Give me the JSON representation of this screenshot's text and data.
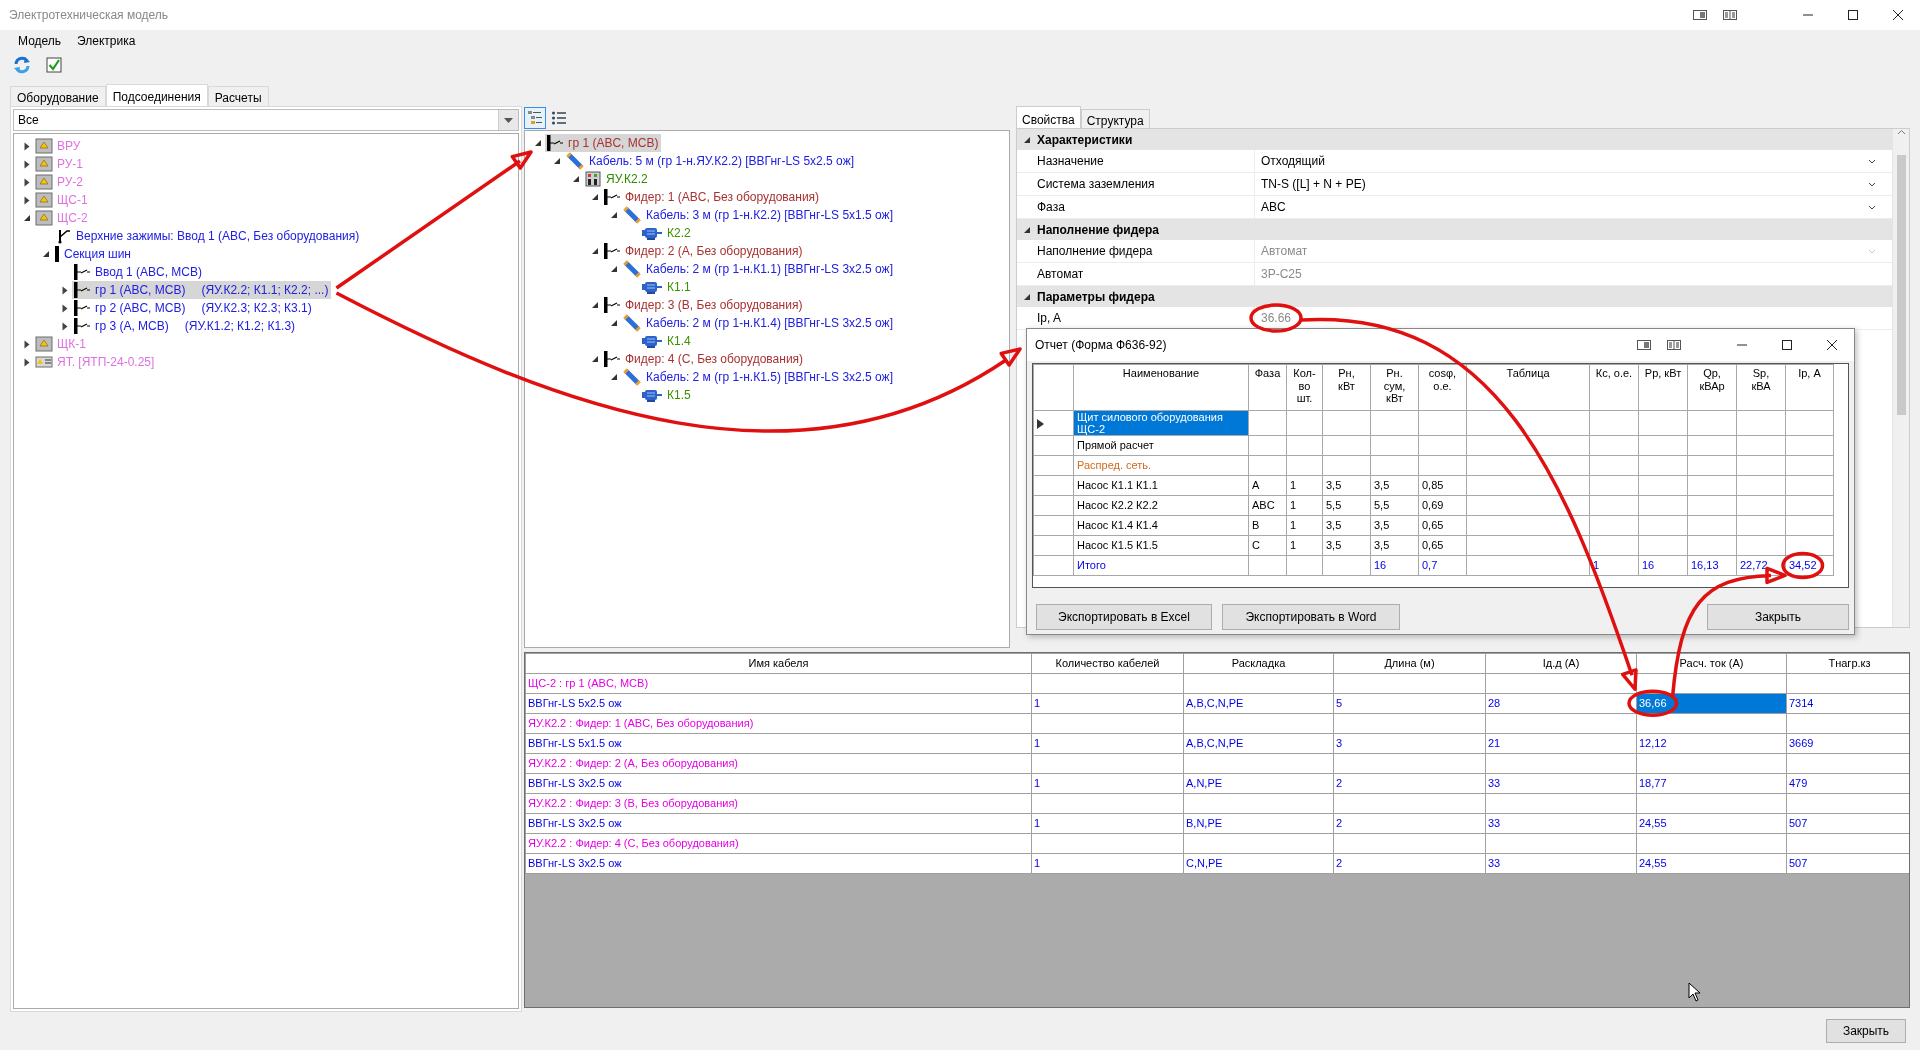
{
  "window": {
    "title": "Электротехническая модель"
  },
  "menu": [
    "Модель",
    "Электрика"
  ],
  "left_tabs": [
    {
      "label": "Оборудование",
      "selected": false
    },
    {
      "label": "Подсоединения",
      "selected": true
    },
    {
      "label": "Расчеты",
      "selected": false
    }
  ],
  "filter": {
    "value": "Все"
  },
  "equipment_tree": [
    {
      "label": "ВРУ",
      "kind": "panel",
      "expanded": false,
      "selected": false
    },
    {
      "label": "РУ-1",
      "kind": "panel",
      "expanded": false,
      "selected": false
    },
    {
      "label": "РУ-2",
      "kind": "panel",
      "expanded": false,
      "selected": false
    },
    {
      "label": "ЩС-1",
      "kind": "panel",
      "expanded": false,
      "selected": false
    },
    {
      "label": "ЩС-2",
      "kind": "panel",
      "expanded": true,
      "selected": false,
      "children": [
        {
          "label": "Верхние зажимы: Ввод 1 (ABC, Без оборудования)",
          "kind": "input",
          "selected": false
        },
        {
          "label": "Секция шин",
          "kind": "bus",
          "expanded": true,
          "selected": false,
          "children": [
            {
              "label": "Ввод 1 (ABC, MCB)",
              "kind": "breaker",
              "selected": false
            },
            {
              "label": "гр 1 (ABC, MCB)",
              "detail": "(ЯУ.К2.2; К1.1; К2.2; ...)",
              "kind": "breaker",
              "expanded": false,
              "selected": true
            },
            {
              "label": "гр 2 (ABC, MCB)",
              "detail": "(ЯУ.К2.3; К2.3; К3.1)",
              "kind": "breaker",
              "expanded": false,
              "selected": false
            },
            {
              "label": "гр 3 (А, MCB)",
              "detail": "(ЯУ.К1.2; К1.2; К1.3)",
              "kind": "breaker",
              "expanded": false,
              "selected": false
            }
          ]
        }
      ]
    },
    {
      "label": "ЩК-1",
      "kind": "panel",
      "expanded": false,
      "selected": false
    },
    {
      "label": "ЯТ. [ЯТП-24-0.25]",
      "kind": "transformer",
      "expanded": false,
      "selected": false
    }
  ],
  "view_modes": [
    {
      "kind": "tree",
      "selected": true
    },
    {
      "kind": "list",
      "selected": false
    }
  ],
  "connection_tree": [
    {
      "label": "гр 1 (ABC, MCB)",
      "kind": "feeder",
      "expanded": true,
      "selected": true,
      "children": [
        {
          "label": "Кабель: 5 м (гр 1-н.ЯУ.К2.2) [ВВГнг-LS 5х2.5 ож]",
          "kind": "cable",
          "expanded": true,
          "selected": false,
          "children": [
            {
              "label": "ЯУ.К2.2",
              "kind": "cabinet",
              "expanded": true,
              "selected": false,
              "children": [
                {
                  "label": "Фидер: 1 (ABC, Без оборудования)",
                  "kind": "feeder",
                  "expanded": true,
                  "selected": false,
                  "children": [
                    {
                      "label": "Кабель: 3 м (гр 1-н.К2.2) [ВВГнг-LS 5х1.5 ож]",
                      "kind": "cable",
                      "expanded": true,
                      "selected": false,
                      "children": [
                        {
                          "label": "К2.2",
                          "kind": "motor",
                          "selected": false
                        }
                      ]
                    }
                  ]
                },
                {
                  "label": "Фидер: 2 (А, Без оборудования)",
                  "kind": "feeder",
                  "expanded": true,
                  "selected": false,
                  "children": [
                    {
                      "label": "Кабель: 2 м (гр 1-н.К1.1) [ВВГнг-LS 3х2.5 ож]",
                      "kind": "cable",
                      "expanded": true,
                      "selected": false,
                      "children": [
                        {
                          "label": "К1.1",
                          "kind": "motor",
                          "selected": false
                        }
                      ]
                    }
                  ]
                },
                {
                  "label": "Фидер: 3 (В, Без оборудования)",
                  "kind": "feeder",
                  "expanded": true,
                  "selected": false,
                  "children": [
                    {
                      "label": "Кабель: 2 м (гр 1-н.К1.4) [ВВГнг-LS 3х2.5 ож]",
                      "kind": "cable",
                      "expanded": true,
                      "selected": false,
                      "children": [
                        {
                          "label": "К1.4",
                          "kind": "motor",
                          "selected": false
                        }
                      ]
                    }
                  ]
                },
                {
                  "label": "Фидер: 4 (С, Без оборудования)",
                  "kind": "feeder",
                  "expanded": true,
                  "selected": false,
                  "children": [
                    {
                      "label": "Кабель: 2 м (гр 1-н.К1.5) [ВВГнг-LS 3х2.5 ож]",
                      "kind": "cable",
                      "expanded": true,
                      "selected": false,
                      "children": [
                        {
                          "label": "К1.5",
                          "kind": "motor",
                          "selected": false
                        }
                      ]
                    }
                  ]
                }
              ]
            }
          ]
        }
      ]
    }
  ],
  "properties": {
    "tabs": [
      {
        "label": "Свойства",
        "selected": true
      },
      {
        "label": "Структура",
        "selected": false
      }
    ],
    "groups": [
      {
        "title": "Характеристики",
        "expanded": true,
        "rows": [
          {
            "name": "Назначение",
            "value": "Отходящий",
            "dropdown": true,
            "disabled": false
          },
          {
            "name": "Система заземления",
            "value": "TN-S ([L] + N + PE)",
            "dropdown": true,
            "disabled": false
          },
          {
            "name": "Фаза",
            "value": "ABC",
            "dropdown": true,
            "disabled": false
          }
        ]
      },
      {
        "title": "Наполнение фидера",
        "expanded": true,
        "rows": [
          {
            "name": "Наполнение фидера",
            "value": "Автомат",
            "dropdown": true,
            "disabled": true
          },
          {
            "name": "Автомат",
            "value": "3P-C25",
            "dropdown": false,
            "disabled": true
          }
        ]
      },
      {
        "title": "Параметры фидера",
        "expanded": true,
        "rows": [
          {
            "name": "Ip, A",
            "value": "36.66",
            "dropdown": false,
            "disabled": true
          }
        ]
      }
    ]
  },
  "report": {
    "title": "Отчет (Форма Ф636-92)",
    "columns": [
      "Наименование",
      "Фаза",
      "Кол-во\nшт.",
      "Рн,\nкВт",
      "Рн.\nсум,\nкВт",
      "cosφ,\nо.е.",
      "Таблица",
      "Кс, о.е.",
      "Рр, кВт",
      "Qр,\nкВАр",
      "Sр,\nкВА",
      "Iр, А"
    ],
    "rows": [
      {
        "kind": "section",
        "selected": true,
        "cells": [
          "Щит силового оборудования ЩС-2",
          null,
          null,
          null,
          null,
          null,
          null,
          null,
          null,
          null,
          null,
          null
        ]
      },
      {
        "kind": "section",
        "selected": false,
        "cells": [
          "Прямой расчет",
          null,
          null,
          null,
          null,
          null,
          null,
          null,
          null,
          null,
          null,
          null
        ]
      },
      {
        "kind": "subsection",
        "selected": false,
        "cells": [
          "Распред. сеть.",
          null,
          null,
          null,
          null,
          null,
          null,
          null,
          null,
          null,
          null,
          null
        ]
      },
      {
        "kind": "item",
        "selected": false,
        "cells": [
          "Насос К1.1 К1.1",
          "A",
          "1",
          "3,5",
          "3,5",
          "0,85",
          null,
          null,
          null,
          null,
          null,
          null
        ]
      },
      {
        "kind": "item",
        "selected": false,
        "cells": [
          "Насос К2.2 К2.2",
          "ABC",
          "1",
          "5,5",
          "5,5",
          "0,69",
          null,
          null,
          null,
          null,
          null,
          null
        ]
      },
      {
        "kind": "item",
        "selected": false,
        "cells": [
          "Насос К1.4 К1.4",
          "B",
          "1",
          "3,5",
          "3,5",
          "0,65",
          null,
          null,
          null,
          null,
          null,
          null
        ]
      },
      {
        "kind": "item",
        "selected": false,
        "cells": [
          "Насос К1.5 К1.5",
          "C",
          "1",
          "3,5",
          "3,5",
          "0,65",
          null,
          null,
          null,
          null,
          null,
          null
        ]
      },
      {
        "kind": "total",
        "selected": false,
        "cells": [
          "Итого",
          null,
          null,
          null,
          "16",
          "0,7",
          null,
          "1",
          "16",
          "16,13",
          "22,72",
          "34,52"
        ]
      }
    ],
    "buttons": [
      "Экспортировать в Excel",
      "Экспортировать в Word",
      "Закрыть"
    ]
  },
  "cable_table": {
    "columns": [
      "Имя кабеля",
      "Количество кабелей",
      "Раскладка",
      "Длина (м)",
      "Iд.д (А)",
      "Расч. ток (А)",
      "Тнагр.кз"
    ],
    "rows": [
      {
        "kind": "group",
        "label": "ЩС-2 : гр 1 (ABC, MCB)"
      },
      {
        "kind": "cable",
        "cells": [
          {
            "text": "ВВГнг-LS 5х2.5 ож",
            "selected": false
          },
          {
            "text": "1",
            "selected": false
          },
          {
            "text": "A,B,C,N,PE",
            "selected": false
          },
          {
            "text": "5",
            "selected": false
          },
          {
            "text": "28",
            "selected": false
          },
          {
            "text": "36,66",
            "selected": true
          },
          {
            "text": "7314",
            "selected": false
          }
        ]
      },
      {
        "kind": "group",
        "label": "ЯУ.К2.2 : Фидер: 1 (ABC, Без оборудования)"
      },
      {
        "kind": "cable",
        "cells": [
          {
            "text": "ВВГнг-LS 5х1.5 ож",
            "selected": false
          },
          {
            "text": "1",
            "selected": false
          },
          {
            "text": "A,B,C,N,PE",
            "selected": false
          },
          {
            "text": "3",
            "selected": false
          },
          {
            "text": "21",
            "selected": false
          },
          {
            "text": "12,12",
            "selected": false
          },
          {
            "text": "3669",
            "selected": false
          }
        ]
      },
      {
        "kind": "group",
        "label": "ЯУ.К2.2 : Фидер: 2 (А, Без оборудования)"
      },
      {
        "kind": "cable",
        "cells": [
          {
            "text": "ВВГнг-LS 3х2.5 ож",
            "selected": false
          },
          {
            "text": "1",
            "selected": false
          },
          {
            "text": "A,N,PE",
            "selected": false
          },
          {
            "text": "2",
            "selected": false
          },
          {
            "text": "33",
            "selected": false
          },
          {
            "text": "18,77",
            "selected": false
          },
          {
            "text": "479",
            "selected": false
          }
        ]
      },
      {
        "kind": "group",
        "label": "ЯУ.К2.2 : Фидер: 3 (В, Без оборудования)"
      },
      {
        "kind": "cable",
        "cells": [
          {
            "text": "ВВГнг-LS 3х2.5 ож",
            "selected": false
          },
          {
            "text": "1",
            "selected": false
          },
          {
            "text": "B,N,PE",
            "selected": false
          },
          {
            "text": "2",
            "selected": false
          },
          {
            "text": "33",
            "selected": false
          },
          {
            "text": "24,55",
            "selected": false
          },
          {
            "text": "507",
            "selected": false
          }
        ]
      },
      {
        "kind": "group",
        "label": "ЯУ.К2.2 : Фидер: 4 (С, Без оборудования)"
      },
      {
        "kind": "cable",
        "cells": [
          {
            "text": "ВВГнг-LS 3х2.5 ож",
            "selected": false
          },
          {
            "text": "1",
            "selected": false
          },
          {
            "text": "C,N,PE",
            "selected": false
          },
          {
            "text": "2",
            "selected": false
          },
          {
            "text": "33",
            "selected": false
          },
          {
            "text": "24,55",
            "selected": false
          },
          {
            "text": "507",
            "selected": false
          }
        ]
      }
    ]
  },
  "footer": {
    "button": "Закрыть"
  }
}
